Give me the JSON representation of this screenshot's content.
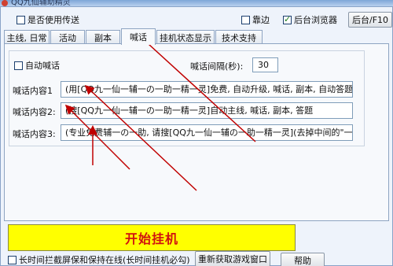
{
  "window": {
    "title": "QQ九仙辅助精灵"
  },
  "top": {
    "use_transfer_label": "是否使用传送",
    "dock_label": "靠边",
    "bg_browser_label": "后台浏览器",
    "bg_browser_checked": true,
    "f10_button": "后台/F10"
  },
  "tabs": [
    {
      "label": "主线, 日常"
    },
    {
      "label": "活动"
    },
    {
      "label": "副本"
    },
    {
      "label": "喊话"
    },
    {
      "label": "挂机状态显示"
    },
    {
      "label": "技术支持"
    }
  ],
  "active_tab": "喊话",
  "shout": {
    "auto_label": "自动喊话",
    "interval_label": "喊话间隔(秒):",
    "interval_value": "30",
    "rows": [
      {
        "label": "喊话内容1",
        "value": "(用[QQ九一仙一辅一の一助一精一灵]免费, 自动升级, 喊话, 副本, 自动答题)"
      },
      {
        "label": "喊话内容2:",
        "value": "(搜[QQ九一仙一辅一の一助一精一灵]自动主线, 喊话, 副本, 答题"
      },
      {
        "label": "喊话内容3:",
        "value": "(专业免费辅一の一助, 请搜[QQ九一仙一辅の一助一精一灵](去掉中间的\"一\"))"
      }
    ]
  },
  "bottom": {
    "start_button": "开始挂机",
    "long_hang_label": "长时间拦截屏保和保持在线(长时间挂机必勾)",
    "refresh_button": "重新获取游戏窗口",
    "help_button": "帮助"
  },
  "colors": {
    "start_bg": "#ffff00",
    "start_text": "#d01010",
    "arrow": "#c00000"
  }
}
